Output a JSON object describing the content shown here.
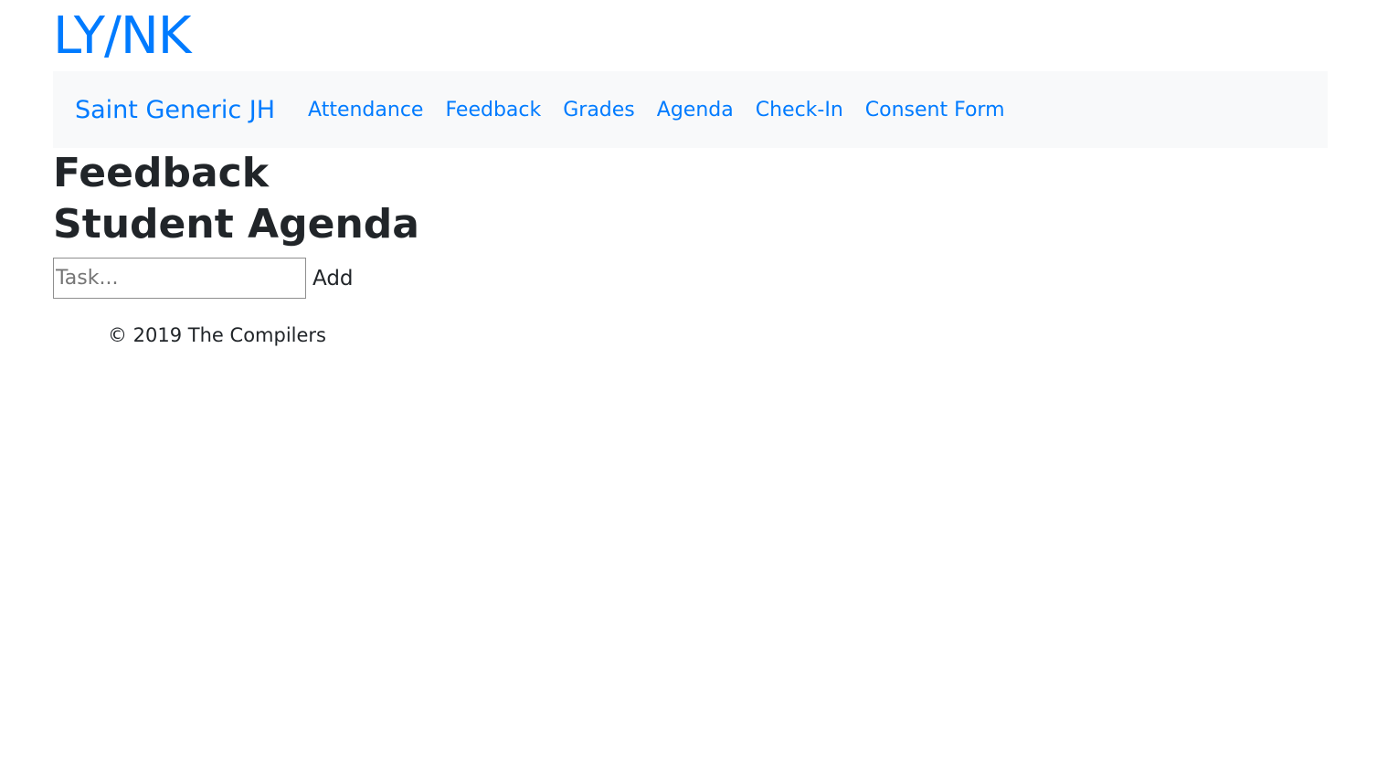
{
  "header": {
    "logo": "LY/NK"
  },
  "navbar": {
    "brand": "Saint Generic JH",
    "links": [
      {
        "label": "Attendance"
      },
      {
        "label": "Feedback"
      },
      {
        "label": "Grades"
      },
      {
        "label": "Agenda"
      },
      {
        "label": "Check-In"
      },
      {
        "label": "Consent Form"
      }
    ]
  },
  "main": {
    "feedback_heading": "Feedback",
    "agenda_heading": "Student Agenda",
    "task_input": {
      "value": "",
      "placeholder": "Task..."
    },
    "add_label": "Add"
  },
  "footer": {
    "text": "© 2019 The Compilers"
  },
  "colors": {
    "accent": "#007bff",
    "navbar_bg": "#f8f9fa",
    "text": "#212529"
  }
}
